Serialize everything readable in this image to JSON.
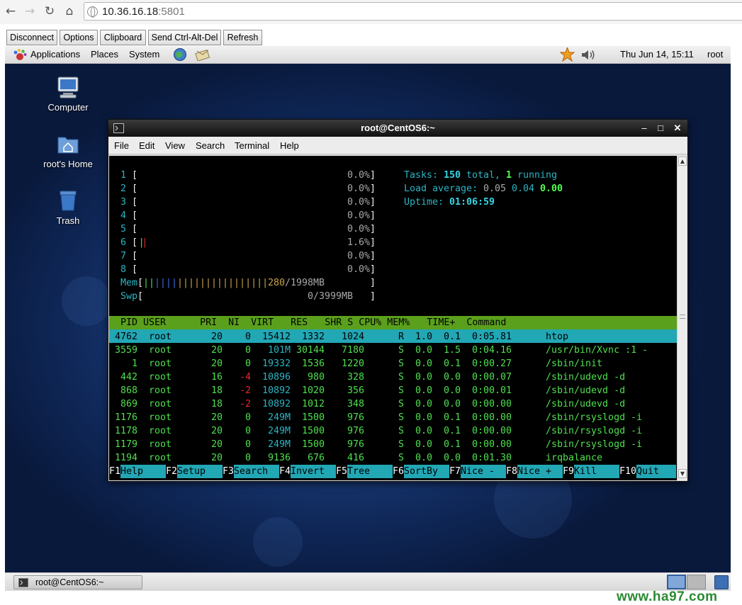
{
  "browser": {
    "url_host": "10.36.16.18",
    "url_port": ":5801"
  },
  "vnc_toolbar": {
    "buttons": [
      "Disconnect",
      "Options",
      "Clipboard",
      "Send Ctrl-Alt-Del",
      "Refresh"
    ]
  },
  "top_panel": {
    "menus": [
      "Applications",
      "Places",
      "System"
    ],
    "clock": "Thu Jun 14, 15:11",
    "user": "root"
  },
  "desktop": {
    "icons": [
      "Computer",
      "root's Home",
      "Trash"
    ]
  },
  "terminal": {
    "title": "root@CentOS6:~",
    "menu": [
      "File",
      "Edit",
      "View",
      "Search",
      "Terminal",
      "Help"
    ]
  },
  "htop": {
    "cpus": [
      {
        "n": "1",
        "pct": "0.0%"
      },
      {
        "n": "2",
        "pct": "0.0%"
      },
      {
        "n": "3",
        "pct": "0.0%"
      },
      {
        "n": "4",
        "pct": "0.0%"
      },
      {
        "n": "5",
        "pct": "0.0%"
      },
      {
        "n": "6",
        "pct": "1.6%"
      },
      {
        "n": "7",
        "pct": "0.0%"
      },
      {
        "n": "8",
        "pct": "0.0%"
      }
    ],
    "mem": {
      "label": "Mem",
      "used": "280",
      "total": "/1998MB"
    },
    "swp": {
      "label": "Swp",
      "used": "0",
      "total": "/3999MB"
    },
    "tasks": {
      "label": "Tasks: ",
      "total": "150",
      "total_word": " total, ",
      "running": "1",
      "running_word": " running"
    },
    "load": {
      "label": "Load average: ",
      "l1": "0.05",
      "l5": "0.04",
      "l15": "0.00"
    },
    "uptime": {
      "label": "Uptime: ",
      "value": "01:06:59"
    },
    "header": "  PID USER      PRI  NI  VIRT   RES   SHR S CPU% MEM%   TIME+  Command",
    "processes": [
      {
        "pid": "4762",
        "user": "root",
        "pri": "20",
        "ni": "0",
        "virt": "15412",
        "res": "1332",
        "shr": "1024",
        "s": "R",
        "cpu": "1.0",
        "mem": "0.1",
        "time": "0:05.81",
        "cmd": "htop"
      },
      {
        "pid": "3559",
        "user": "root",
        "pri": "20",
        "ni": "0",
        "virt": "101M",
        "res": "30144",
        "shr": "7180",
        "s": "S",
        "cpu": "0.0",
        "mem": "1.5",
        "time": "0:04.16",
        "cmd": "/usr/bin/Xvnc :1 -"
      },
      {
        "pid": "1",
        "user": "root",
        "pri": "20",
        "ni": "0",
        "virt": "19332",
        "res": "1536",
        "shr": "1220",
        "s": "S",
        "cpu": "0.0",
        "mem": "0.1",
        "time": "0:00.27",
        "cmd": "/sbin/init"
      },
      {
        "pid": "442",
        "user": "root",
        "pri": "16",
        "ni": "-4",
        "virt": "10896",
        "res": "980",
        "shr": "328",
        "s": "S",
        "cpu": "0.0",
        "mem": "0.0",
        "time": "0:00.07",
        "cmd": "/sbin/udevd -d"
      },
      {
        "pid": "868",
        "user": "root",
        "pri": "18",
        "ni": "-2",
        "virt": "10892",
        "res": "1020",
        "shr": "356",
        "s": "S",
        "cpu": "0.0",
        "mem": "0.0",
        "time": "0:00.01",
        "cmd": "/sbin/udevd -d"
      },
      {
        "pid": "869",
        "user": "root",
        "pri": "18",
        "ni": "-2",
        "virt": "10892",
        "res": "1012",
        "shr": "348",
        "s": "S",
        "cpu": "0.0",
        "mem": "0.0",
        "time": "0:00.00",
        "cmd": "/sbin/udevd -d"
      },
      {
        "pid": "1176",
        "user": "root",
        "pri": "20",
        "ni": "0",
        "virt": "249M",
        "res": "1500",
        "shr": "976",
        "s": "S",
        "cpu": "0.0",
        "mem": "0.1",
        "time": "0:00.00",
        "cmd": "/sbin/rsyslogd -i"
      },
      {
        "pid": "1178",
        "user": "root",
        "pri": "20",
        "ni": "0",
        "virt": "249M",
        "res": "1500",
        "shr": "976",
        "s": "S",
        "cpu": "0.0",
        "mem": "0.1",
        "time": "0:00.00",
        "cmd": "/sbin/rsyslogd -i"
      },
      {
        "pid": "1179",
        "user": "root",
        "pri": "20",
        "ni": "0",
        "virt": "249M",
        "res": "1500",
        "shr": "976",
        "s": "S",
        "cpu": "0.0",
        "mem": "0.1",
        "time": "0:00.00",
        "cmd": "/sbin/rsyslogd -i"
      },
      {
        "pid": "1194",
        "user": "root",
        "pri": "20",
        "ni": "0",
        "virt": "9136",
        "res": "676",
        "shr": "416",
        "s": "S",
        "cpu": "0.0",
        "mem": "0.0",
        "time": "0:01.30",
        "cmd": "irqbalance"
      }
    ],
    "fkeys": [
      {
        "key": "F1",
        "label": "Help"
      },
      {
        "key": "F2",
        "label": "Setup"
      },
      {
        "key": "F3",
        "label": "Search"
      },
      {
        "key": "F4",
        "label": "Invert"
      },
      {
        "key": "F5",
        "label": "Tree"
      },
      {
        "key": "F6",
        "label": "SortBy"
      },
      {
        "key": "F7",
        "label": "Nice -"
      },
      {
        "key": "F8",
        "label": "Nice +"
      },
      {
        "key": "F9",
        "label": "Kill"
      },
      {
        "key": "F10",
        "label": "Quit"
      }
    ]
  },
  "bottom_panel": {
    "task": "root@CentOS6:~"
  },
  "watermark": "www.ha97.com",
  "colors": {
    "terminal_bg": "#000000",
    "htop_header": "#5ba01c",
    "htop_select": "#22a7b5",
    "htop_green": "#4ee04e",
    "htop_cyan": "#2ab5c4"
  }
}
